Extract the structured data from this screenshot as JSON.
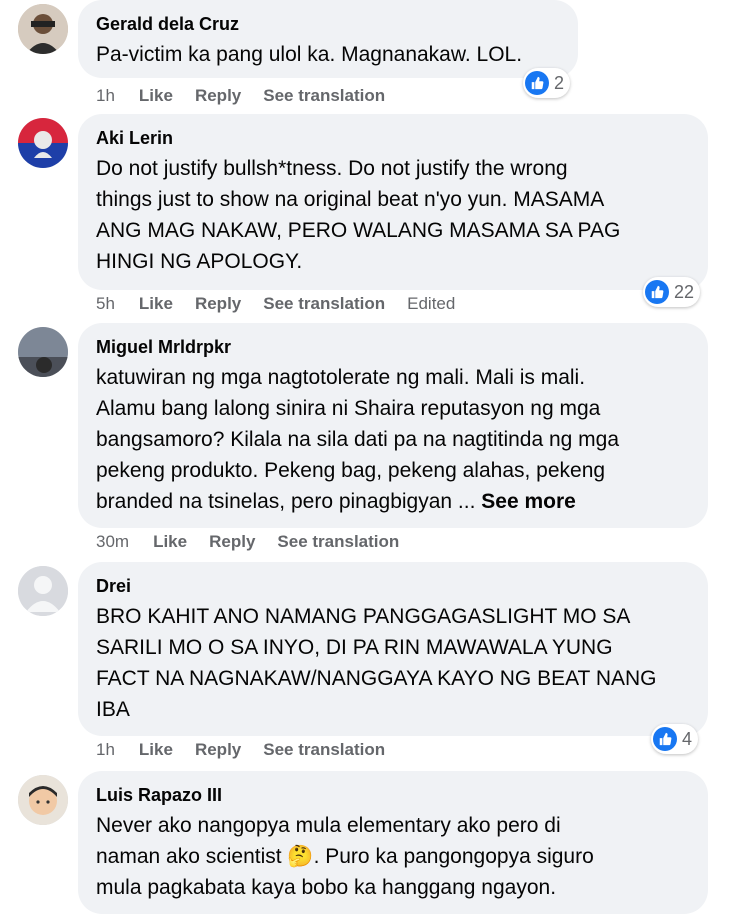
{
  "comments": [
    {
      "author": "Gerald dela Cruz",
      "text": "Pa-victim ka pang ulol ka. Magnanakaw. LOL.",
      "time": "1h",
      "like": "Like",
      "reply": "Reply",
      "translate": "See translation",
      "reactions": "2"
    },
    {
      "author": "Aki Lerin",
      "text": "Do not justify bullsh*tness. Do not justify the wrong\nthings just to show na original beat n'yo yun. MASAMA\nANG MAG NAKAW, PERO WALANG MASAMA SA PAG\nHINGI NG APOLOGY.",
      "time": "5h",
      "like": "Like",
      "reply": "Reply",
      "translate": "See translation",
      "edited": "Edited",
      "reactions": "22"
    },
    {
      "author": "Miguel Mrldrpkr",
      "text": "katuwiran ng mga nagtotolerate ng mali. Mali is mali.\nAlamu bang lalong sinira ni Shaira reputasyon ng mga\nbangsamoro? Kilala na sila dati pa na nagtitinda ng mga\npekeng produkto. Pekeng bag, pekeng alahas, pekeng\nbranded na tsinelas, pero pinagbigyan ...",
      "see_more": "See more",
      "time": "30m",
      "like": "Like",
      "reply": "Reply",
      "translate": "See translation"
    },
    {
      "author": "Drei",
      "text": "BRO KAHIT ANO NAMANG PANGGAGASLIGHT MO SA\nSARILI MO O SA INYO, DI PA RIN MAWAWALA YUNG\nFACT NA NAGNAKAW/NANGGAYA KAYO NG BEAT NANG\nIBA",
      "time": "1h",
      "like": "Like",
      "reply": "Reply",
      "translate": "See translation",
      "reactions": "4"
    },
    {
      "author": "Luis Rapazo III",
      "text": "Never ako nangopya mula elementary ako pero di\nnaman ako scientist 🤔. Puro ka pangongopya siguro\nmula pagkabata kaya bobo ka hanggang ngayon."
    }
  ],
  "colors": {
    "bubble": "#f0f2f5",
    "meta": "#65676b",
    "like_blue": "#1877f2"
  }
}
